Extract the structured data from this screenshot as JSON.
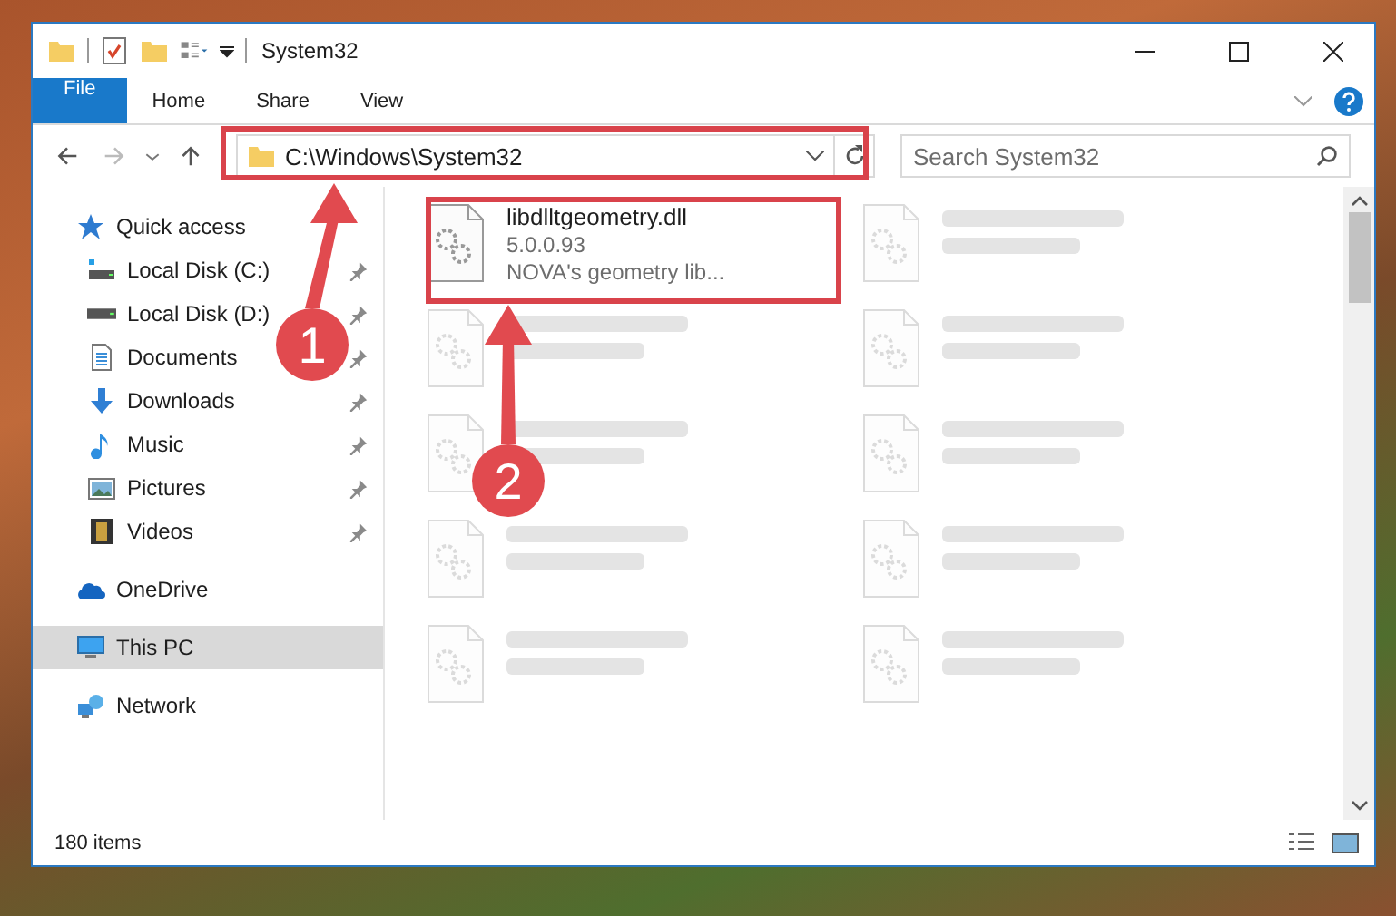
{
  "window": {
    "title": "System32"
  },
  "ribbon": {
    "tabs": [
      {
        "label": "File",
        "kind": "file"
      },
      {
        "label": "Home",
        "kind": "tab"
      },
      {
        "label": "Share",
        "kind": "tab"
      },
      {
        "label": "View",
        "kind": "tab"
      }
    ]
  },
  "address": {
    "path": "C:\\Windows\\System32"
  },
  "search": {
    "placeholder": "Search System32"
  },
  "nav": {
    "items": [
      {
        "label": "Quick access",
        "kind": "star",
        "selected": false,
        "children": [
          {
            "label": "Local Disk (C:)",
            "kind": "system-disk",
            "pinned": true,
            "selected": false
          },
          {
            "label": "Local Disk (D:)",
            "kind": "disk",
            "pinned": true,
            "selected": false
          },
          {
            "label": "Documents",
            "kind": "document",
            "pinned": true,
            "selected": false
          },
          {
            "label": "Downloads",
            "kind": "download",
            "pinned": true,
            "selected": false
          },
          {
            "label": "Music",
            "kind": "music",
            "pinned": true,
            "selected": false
          },
          {
            "label": "Pictures",
            "kind": "picture",
            "pinned": true,
            "selected": false
          },
          {
            "label": "Videos",
            "kind": "video",
            "pinned": true,
            "selected": false
          }
        ]
      },
      {
        "label": "OneDrive",
        "kind": "cloud",
        "selected": false
      },
      {
        "label": "This PC",
        "kind": "pc",
        "selected": true
      },
      {
        "label": "Network",
        "kind": "network",
        "selected": false
      }
    ]
  },
  "files": [
    {
      "kind": "file",
      "name": "libdlltgeometry.dll",
      "lines": [
        "5.0.0.93",
        "NOVA's geometry lib..."
      ]
    },
    {
      "kind": "obscured"
    },
    {
      "kind": "obscured"
    },
    {
      "kind": "obscured"
    },
    {
      "kind": "obscured"
    },
    {
      "kind": "obscured"
    },
    {
      "kind": "obscured"
    },
    {
      "kind": "obscured"
    },
    {
      "kind": "obscured"
    },
    {
      "kind": "obscured"
    }
  ],
  "status_bar": {
    "count": "180 items"
  },
  "annotations": [
    {
      "label": "1"
    },
    {
      "label": "2"
    }
  ]
}
